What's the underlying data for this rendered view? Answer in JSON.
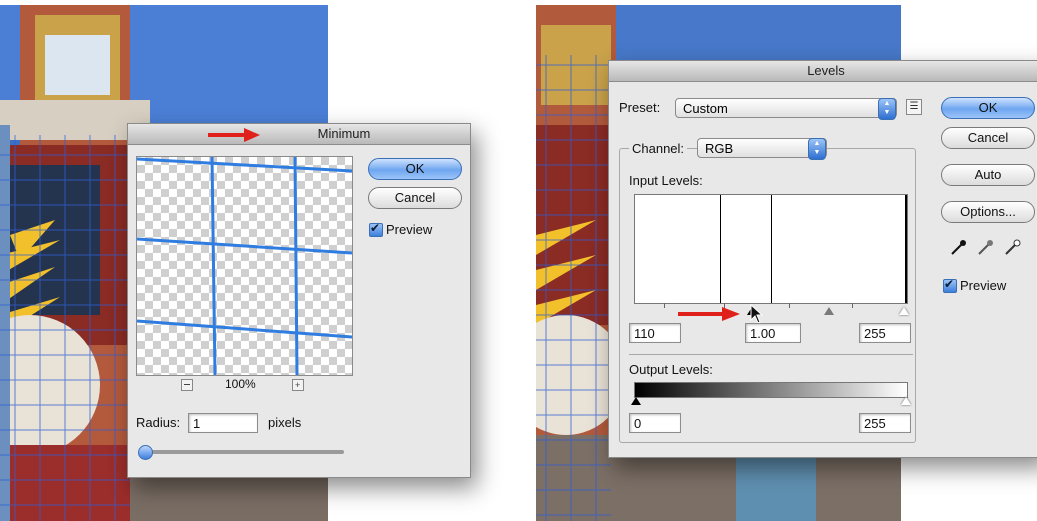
{
  "minimum_dialog": {
    "title": "Minimum",
    "ok_label": "OK",
    "cancel_label": "Cancel",
    "preview_label": "Preview",
    "preview_checked": true,
    "zoom_percent": "100%",
    "zoom_out_icon": "zoom-out-icon",
    "zoom_in_icon": "zoom-in-icon",
    "radius_label": "Radius:",
    "radius_value": "1",
    "radius_unit": "pixels",
    "radius_slider_level": 0.0
  },
  "levels_dialog": {
    "title": "Levels",
    "preset_label": "Preset:",
    "preset_value": "Custom",
    "preset_options_icon": "preset-options-icon",
    "channel_label": "Channel:",
    "channel_value": "RGB",
    "input_levels_label": "Input Levels:",
    "input_black": "110",
    "input_gamma": "1.00",
    "input_white": "255",
    "output_levels_label": "Output Levels:",
    "output_black": "0",
    "output_white": "255",
    "ok_label": "OK",
    "cancel_label": "Cancel",
    "auto_label": "Auto",
    "options_label": "Options...",
    "preview_label": "Preview",
    "preview_checked": true,
    "eyedropper_icons": [
      "black-eyedropper-icon",
      "gray-eyedropper-icon",
      "white-eyedropper-icon"
    ]
  },
  "annotations": {
    "arrow_color": "#e0201b",
    "grid_color": "#2f7de0"
  }
}
